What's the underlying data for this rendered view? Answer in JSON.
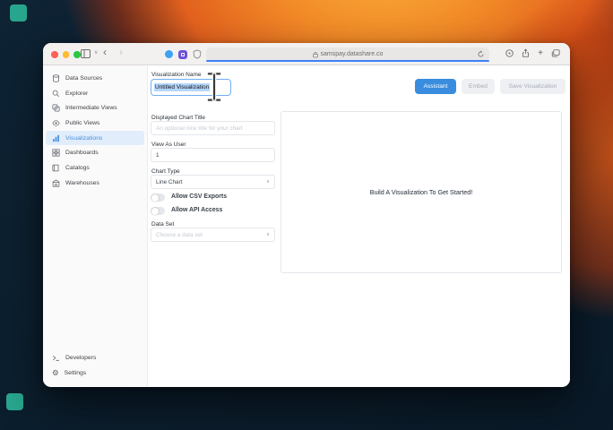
{
  "browser": {
    "url": "samspay.datashare.co"
  },
  "sidebar": {
    "items": [
      {
        "label": "Data Sources",
        "icon": "database-icon",
        "active": false
      },
      {
        "label": "Explorer",
        "icon": "search-icon",
        "active": false
      },
      {
        "label": "Intermediate Views",
        "icon": "layers-icon",
        "active": false
      },
      {
        "label": "Public Views",
        "icon": "eye-icon",
        "active": false
      },
      {
        "label": "Visualizations",
        "icon": "bar-chart-icon",
        "active": true
      },
      {
        "label": "Dashboards",
        "icon": "grid-icon",
        "active": false
      },
      {
        "label": "Catalogs",
        "icon": "book-icon",
        "active": false
      },
      {
        "label": "Warehouses",
        "icon": "warehouse-icon",
        "active": false
      }
    ],
    "footer_items": [
      {
        "label": "Developers",
        "icon": "terminal-icon"
      },
      {
        "label": "Settings",
        "icon": "gear-icon"
      }
    ]
  },
  "header": {
    "name_label": "Visualization Name",
    "name_value": "Untitled Visualization",
    "assistant_label": "Assistant",
    "embed_label": "Embed",
    "save_label": "Save Visualization"
  },
  "form": {
    "chart_title": {
      "label": "Displayed Chart Title",
      "placeholder": "An optional nice title for your chart"
    },
    "view_as_user": {
      "label": "View As User",
      "value": "1"
    },
    "chart_type": {
      "label": "Chart Type",
      "value": "Line Chart"
    },
    "toggles": [
      {
        "label": "Allow CSV Exports",
        "on": false
      },
      {
        "label": "Allow API Access",
        "on": false
      }
    ],
    "data_set": {
      "label": "Data Set",
      "placeholder": "Choose a data set"
    }
  },
  "preview": {
    "empty_text": "Build A Visualization To Get Started!"
  },
  "colors": {
    "accent_blue": "#3a8dde",
    "active_item_bg": "#e1edfb",
    "selection_highlight": "#b5d6fc",
    "url_progress": "#3b82f6"
  }
}
